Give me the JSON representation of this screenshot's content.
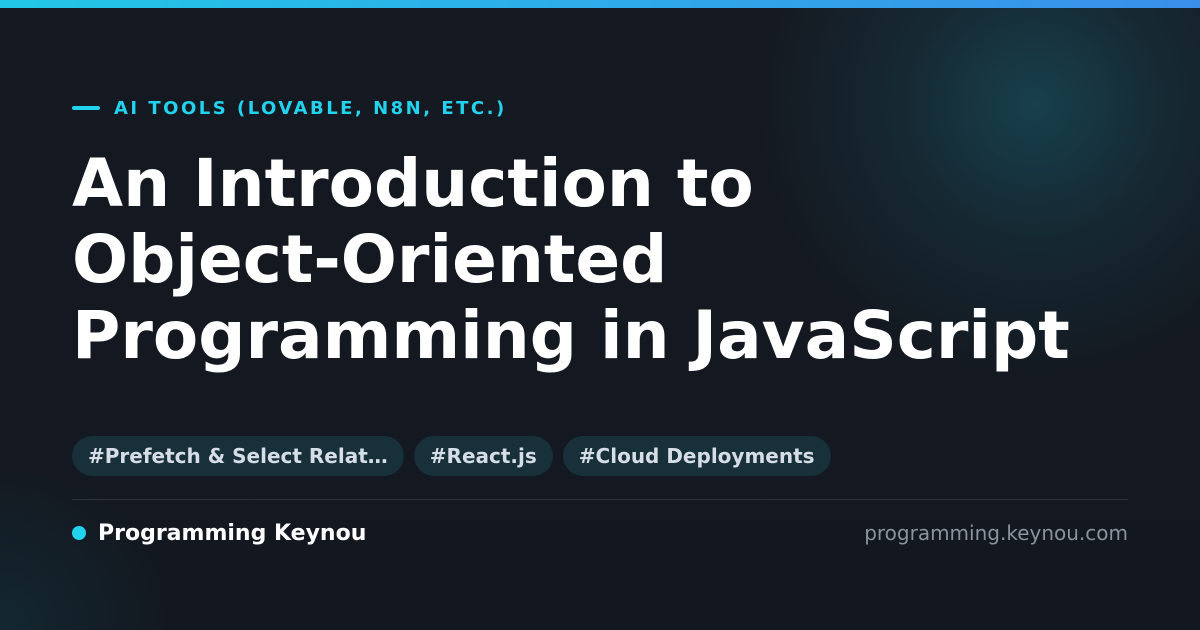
{
  "colors": {
    "accent": "#22d3ee",
    "background": "#141820",
    "title": "#ffffff",
    "tag_background": "#17303a",
    "tag_text": "#d6dde6",
    "muted": "#8a939e"
  },
  "category": "AI TOOLS (LOVABLE, N8N, ETC.)",
  "title_lines": [
    "An Introduction to",
    "Object-Oriented",
    "Programming in JavaScript"
  ],
  "tags": [
    "#Prefetch & Select Relat…",
    "#React.js",
    "#Cloud Deployments"
  ],
  "footer": {
    "site_name": "Programming Keynou",
    "domain": "programming.keynou.com"
  }
}
